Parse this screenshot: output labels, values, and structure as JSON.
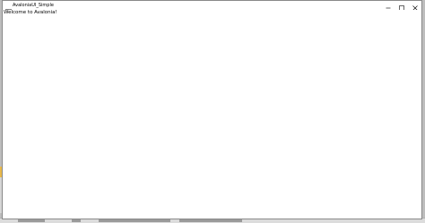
{
  "window": {
    "title": "AvaloniaUI_Simple",
    "app_icon": "app-icon",
    "buttons": {
      "minimize_icon": "minimize-icon",
      "maximize_icon": "maximize-icon",
      "close_icon": "close-icon"
    }
  },
  "content": {
    "welcome_text": "Welcome to Avalonia!"
  },
  "colors": {
    "window_bg": "#ffffff",
    "text": "#000000",
    "desktop_bg": "#bdbdbd"
  }
}
